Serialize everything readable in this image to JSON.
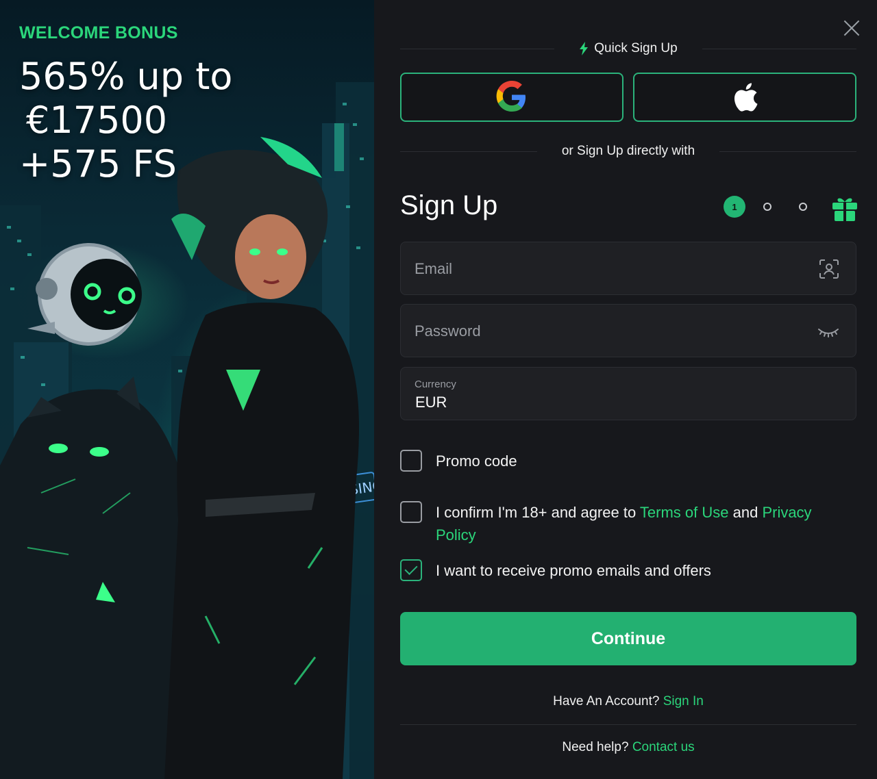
{
  "promo": {
    "tag": "WELCOME BONUS",
    "headline_line1": "565% up to",
    "headline_line2": "€17500",
    "headline_line3": "+575 FS",
    "sign_text": "CASINO",
    "accent_color": "#2bd67b"
  },
  "dialog": {
    "close_icon": "close-icon",
    "quick_signup_label": "Quick Sign Up",
    "social": [
      {
        "name": "google",
        "icon": "google-icon"
      },
      {
        "name": "apple",
        "icon": "apple-icon"
      }
    ],
    "or_signup_label": "or Sign Up directly with",
    "title": "Sign Up",
    "steps": {
      "current": "1",
      "total_dots": 3,
      "reward_icon": "gift-icon"
    },
    "email": {
      "placeholder": "Email",
      "value": "",
      "icon": "face-scan-icon"
    },
    "password": {
      "placeholder": "Password",
      "value": "",
      "icon": "eye-closed-icon"
    },
    "currency": {
      "label": "Currency",
      "value": "EUR"
    },
    "promo_code": {
      "label": "Promo code",
      "checked": false
    },
    "terms": {
      "checked": false,
      "prefix": "I confirm I'm 18+ and agree to ",
      "terms_link": "Terms of Use",
      "middle": " and ",
      "privacy_link": "Privacy Policy"
    },
    "promo_emails": {
      "label": "I want to receive promo emails and offers",
      "checked": true
    },
    "continue_label": "Continue",
    "have_account": "Have An Account?",
    "sign_in_link": "Sign In",
    "need_help": "Need help?",
    "contact_link": "Contact us",
    "brand_color": "#23b071"
  }
}
